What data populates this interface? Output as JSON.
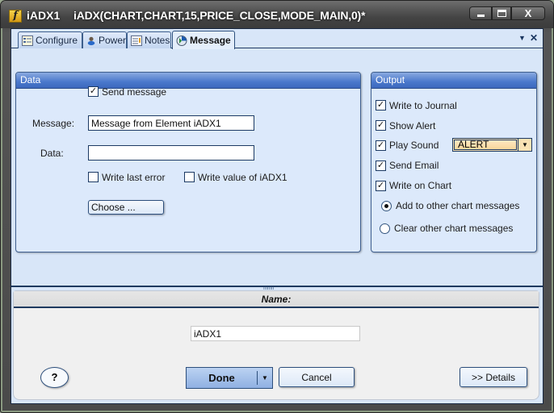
{
  "window": {
    "app_icon": "function-f-icon",
    "name": "iADX1",
    "expression": "iADX(CHART,CHART,15,PRICE_CLOSE,MODE_MAIN,0)*",
    "controls": {
      "minimize": "minimize",
      "maximize": "maximize",
      "close": "X"
    }
  },
  "tabs": [
    {
      "label": "Configure",
      "icon": "configure-icon",
      "active": false
    },
    {
      "label": "Power",
      "icon": "power-icon",
      "active": false
    },
    {
      "label": "Notes",
      "icon": "notes-icon",
      "active": false
    },
    {
      "label": "Message",
      "icon": "message-globe-icon",
      "active": true
    }
  ],
  "tabstrip_controls": {
    "dropdown": "▼",
    "close": "✕"
  },
  "data_group": {
    "title": "Data",
    "send_message": {
      "label": "Send message",
      "checked": true
    },
    "message_label": "Message:",
    "message_value": "Message from Element iADX1",
    "data_label": "Data:",
    "data_value": "",
    "write_last_error": {
      "label": "Write last error",
      "checked": false
    },
    "write_value": {
      "label": "Write value of iADX1",
      "checked": false
    },
    "choose_button": "Choose ..."
  },
  "output_group": {
    "title": "Output",
    "write_to_journal": {
      "label": "Write to Journal",
      "checked": true
    },
    "show_alert": {
      "label": "Show Alert",
      "checked": true
    },
    "play_sound": {
      "label": "Play Sound",
      "checked": true
    },
    "sound_value": "ALERT",
    "send_email": {
      "label": "Send Email",
      "checked": true
    },
    "write_on_chart": {
      "label": "Write on Chart",
      "checked": true
    },
    "add_to_other": {
      "label": "Add to other chart messages",
      "selected": true
    },
    "clear_other": {
      "label": "Clear other chart messages",
      "selected": false
    }
  },
  "name_section": {
    "header": "Name:",
    "value": "iADX1"
  },
  "footer": {
    "help": "?",
    "done": "Done",
    "cancel": "Cancel",
    "details": ">> Details"
  },
  "glyphs": {
    "check": "✓",
    "dropdown": "▼",
    "grip": "ıııııııı"
  }
}
